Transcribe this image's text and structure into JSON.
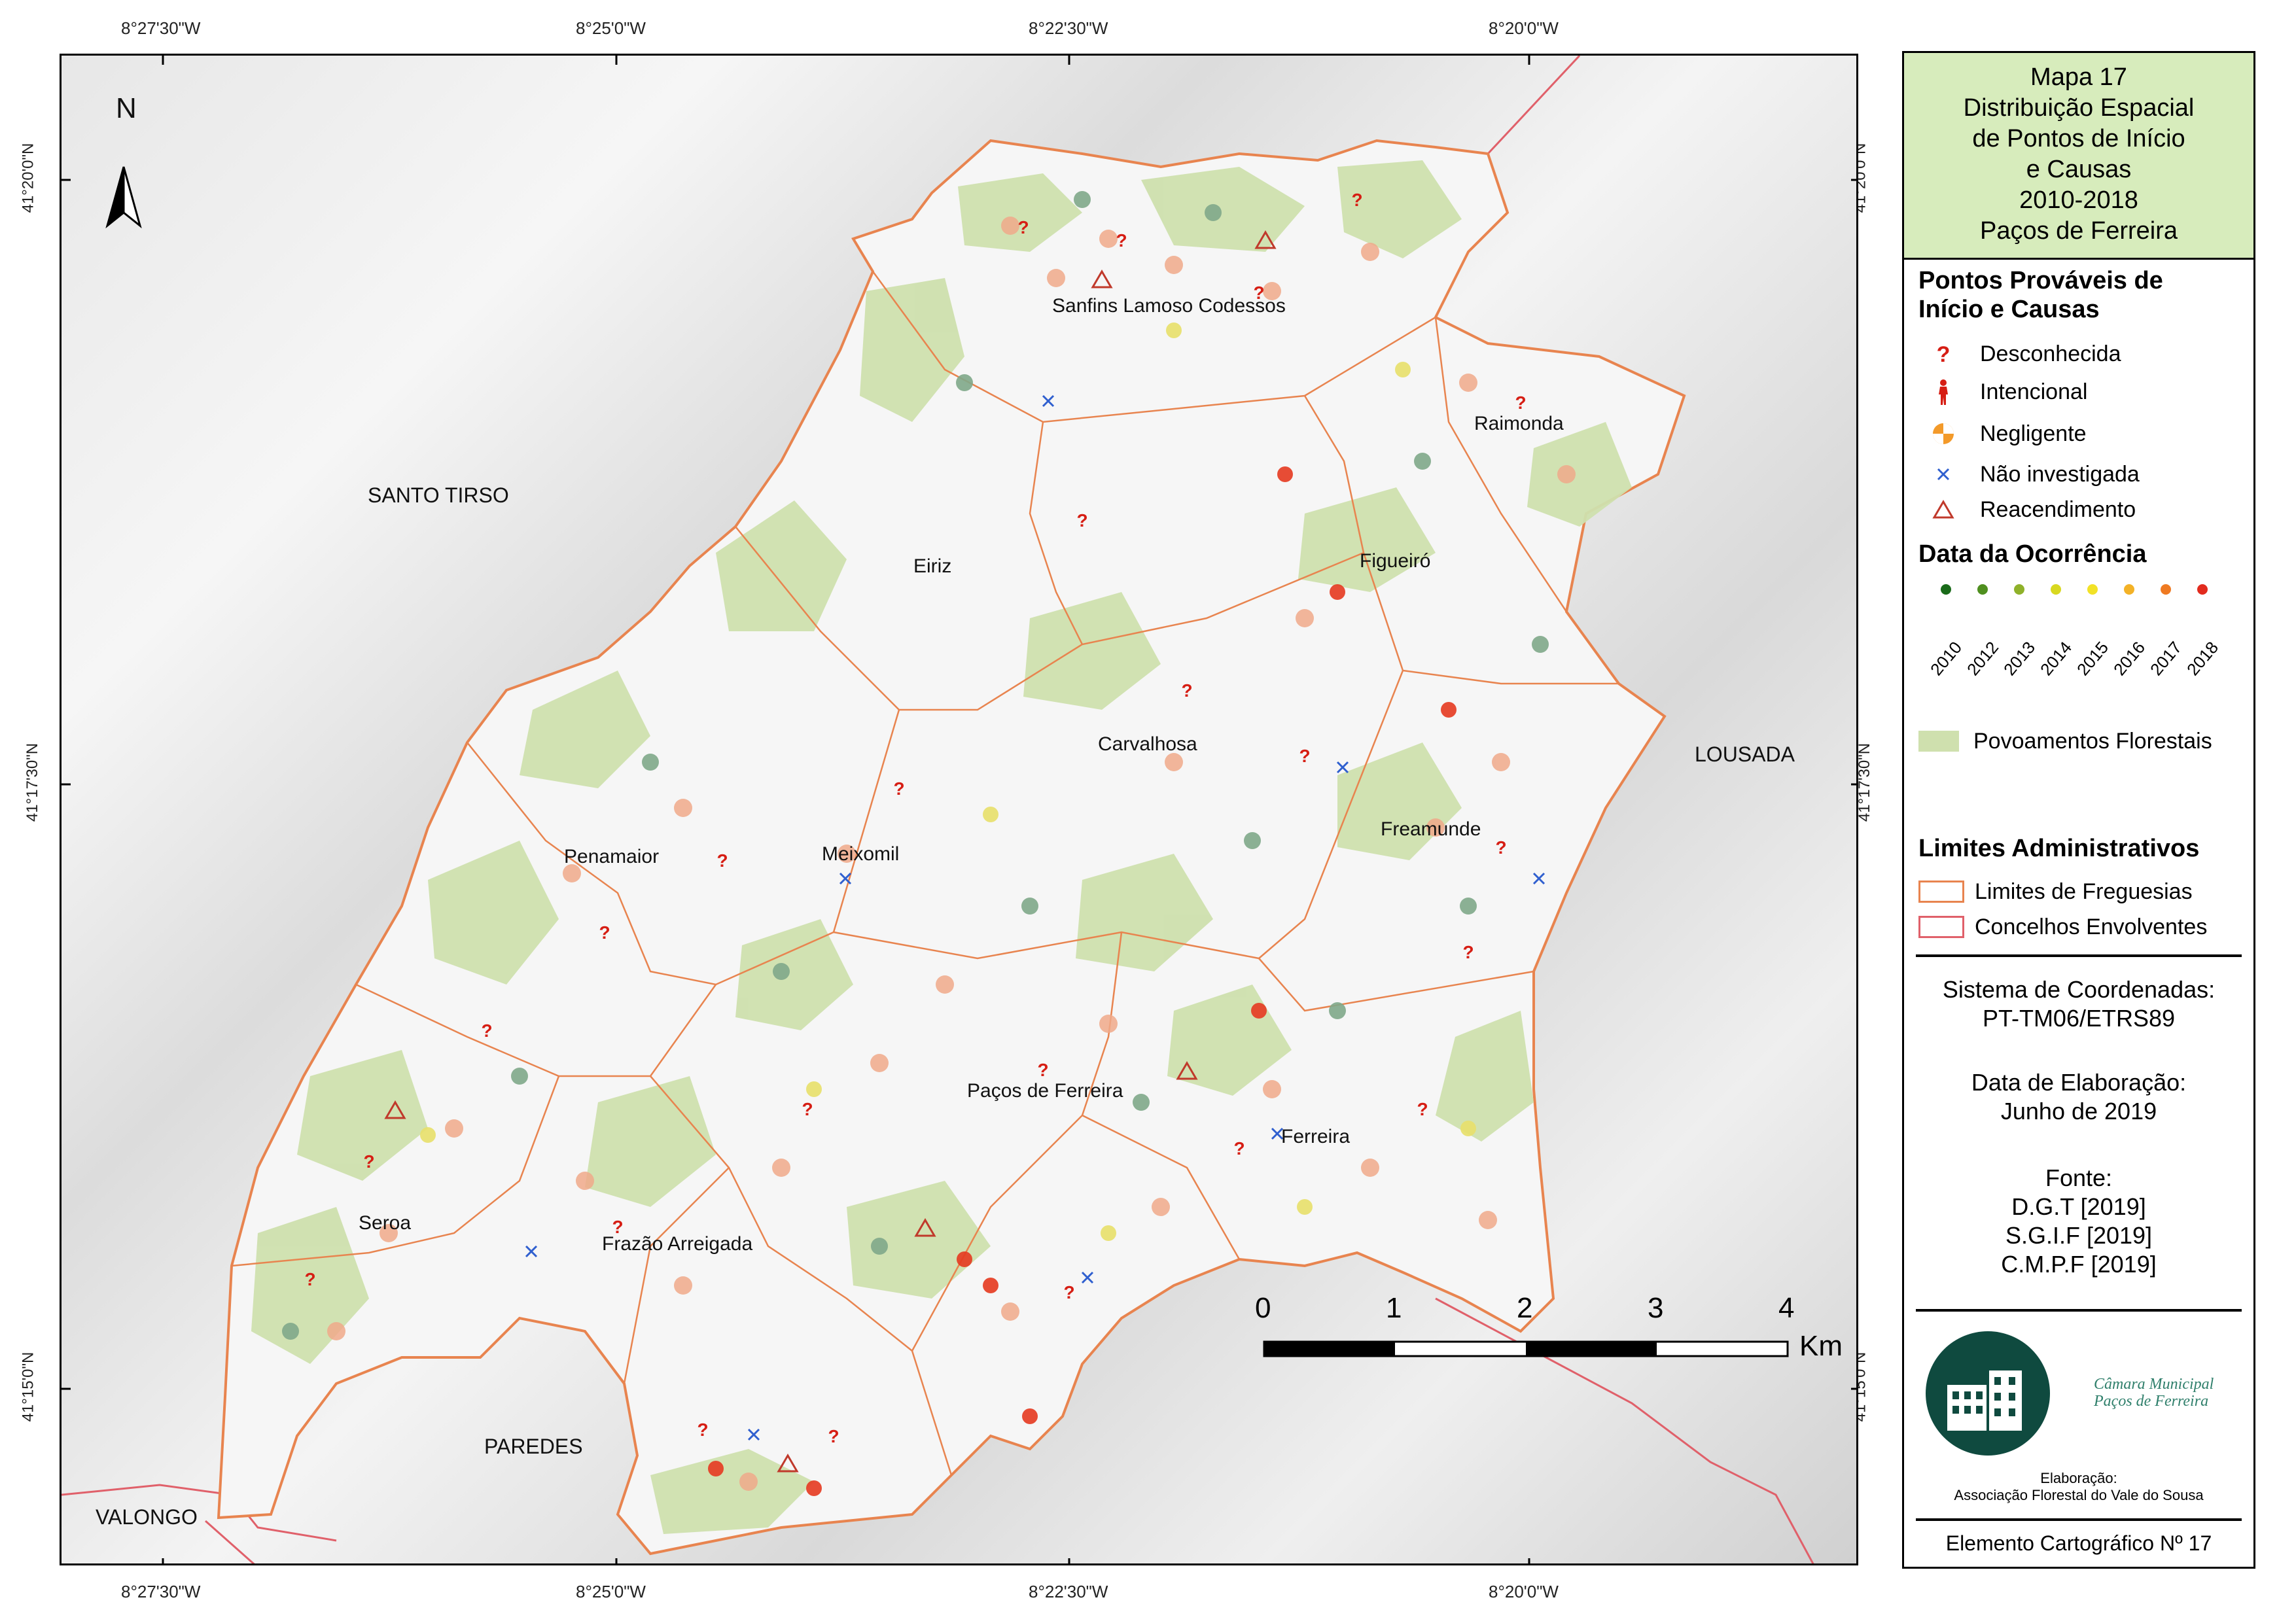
{
  "map": {
    "top_longitudes": [
      "8°27'30\"W",
      "8°25'0\"W",
      "8°22'30\"W",
      "8°20'0\"W"
    ],
    "bottom_longitudes": [
      "8°27'30\"W",
      "8°25'0\"W",
      "8°22'30\"W",
      "8°20'0\"W"
    ],
    "left_latitudes": [
      "41°20'0\"N",
      "41°17'30\"N",
      "41°15'0\"N"
    ],
    "right_latitudes": [
      "41°20'0\"N",
      "41°17'30\"N",
      "41°15'0\"N"
    ],
    "north_label": "N",
    "neighbors": [
      {
        "name": "SANTO TIRSO"
      },
      {
        "name": "LOUSADA"
      },
      {
        "name": "PAREDES"
      },
      {
        "name": "VALONGO"
      }
    ],
    "parishes": [
      {
        "name": "Sanfins Lamoso Codessos"
      },
      {
        "name": "Raimonda"
      },
      {
        "name": "Eiriz"
      },
      {
        "name": "Figueiró"
      },
      {
        "name": "Carvalhosa"
      },
      {
        "name": "Freamunde"
      },
      {
        "name": "Penamaior"
      },
      {
        "name": "Meixomil"
      },
      {
        "name": "Paços de Ferreira"
      },
      {
        "name": "Ferreira"
      },
      {
        "name": "Seroa"
      },
      {
        "name": "Frazão Arreigada"
      }
    ],
    "scale": {
      "ticks": [
        "0",
        "1",
        "2",
        "3",
        "4"
      ],
      "unit": "Km"
    }
  },
  "legend": {
    "title_lines": [
      "Mapa 17",
      "Distribuição Espacial",
      "de Pontos de Início",
      "e Causas",
      "2010-2018",
      "Paços de Ferreira"
    ],
    "causes_heading": [
      "Pontos Prováveis de",
      "Início e Causas"
    ],
    "causes": [
      {
        "label": "Desconhecida",
        "icon": "question-mark-icon"
      },
      {
        "label": "Intencional",
        "icon": "person-icon"
      },
      {
        "label": "Negligente",
        "icon": "negligent-icon"
      },
      {
        "label": "Não investigada",
        "icon": "cross-icon"
      },
      {
        "label": "Reacendimento",
        "icon": "triangle-icon"
      }
    ],
    "date_heading": "Data da Ocorrência",
    "years": [
      "2010",
      "2012",
      "2013",
      "2014",
      "2015",
      "2016",
      "2017",
      "2018"
    ],
    "year_colors": [
      "#1a6b1a",
      "#4f8f1f",
      "#8fb12a",
      "#d8d820",
      "#f2e227",
      "#f3b227",
      "#ef7a22",
      "#e22b1e"
    ],
    "forest_label": "Povoamentos Florestais",
    "admin_heading": "Limites Administrativos",
    "admin": [
      {
        "label": "Limites de Freguesias",
        "color": "#e8844f"
      },
      {
        "label": "Concelhos Envolventes",
        "color": "#e0606a"
      }
    ],
    "crs_lines": [
      "Sistema de Coordenadas:",
      "PT-TM06/ETRS89"
    ],
    "date_lines": [
      "Data de Elaboração:",
      "Junho de 2019"
    ],
    "source_lines": [
      "Fonte:",
      "D.G.T [2019]",
      "S.G.I.F [2019]",
      "C.M.P.F [2019]"
    ],
    "logo_text": [
      "Câmara Municipal",
      "Paços de Ferreira"
    ],
    "credit_lines": [
      "Elaboração:",
      "Associação Florestal do Vale do Sousa"
    ],
    "element_label": "Elemento Cartográfico Nº 17"
  }
}
